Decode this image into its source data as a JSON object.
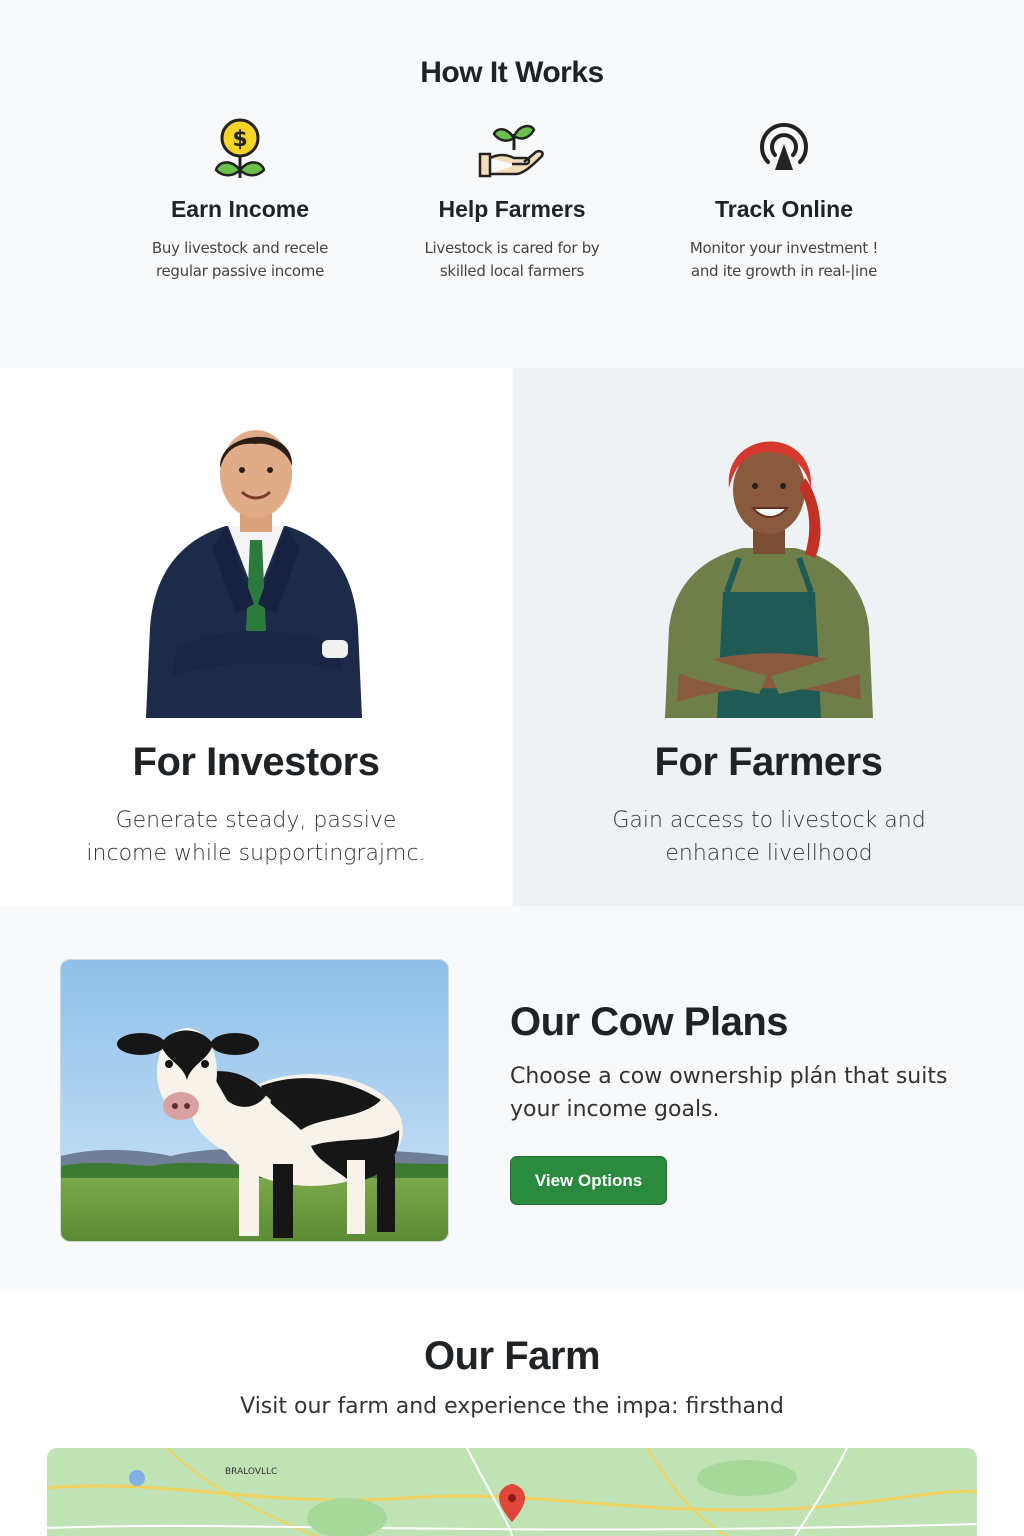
{
  "how_it_works": {
    "title": "How It Works",
    "features": [
      {
        "icon": "money-plant-icon",
        "title": "Earn Income",
        "line1": "Buy livestock and recele",
        "line2": "regular passive income"
      },
      {
        "icon": "hand-sprout-icon",
        "title": "Help Farmers",
        "line1": "Livestock is cared for by",
        "line2": "skilled local farmers"
      },
      {
        "icon": "signal-tower-icon",
        "title": "Track Online",
        "line1": "Monitor your investment !",
        "line2": "and ite growth in real-|ine"
      }
    ]
  },
  "investors": {
    "title": "For Investors",
    "line1": "Generate steady, passive",
    "line2": "income while supportingrajmc."
  },
  "farmers": {
    "title": "For Farmers",
    "line1": "Gain access to livestock and",
    "line2": "enhance livellhood"
  },
  "plans": {
    "title": "Our Cow Plans",
    "line1": "Choose a cow ownership plán  that suits",
    "line2": "your income goals.",
    "button": "View Options"
  },
  "farm": {
    "title": "Our Farm",
    "subtitle": "Visit our farm and experience the impa: firsthand",
    "map_label": "BRALOVLLC"
  },
  "colors": {
    "accent": "#2a8a3e",
    "background": "#f7f9fb",
    "farmer_panel": "#eef2f5"
  }
}
